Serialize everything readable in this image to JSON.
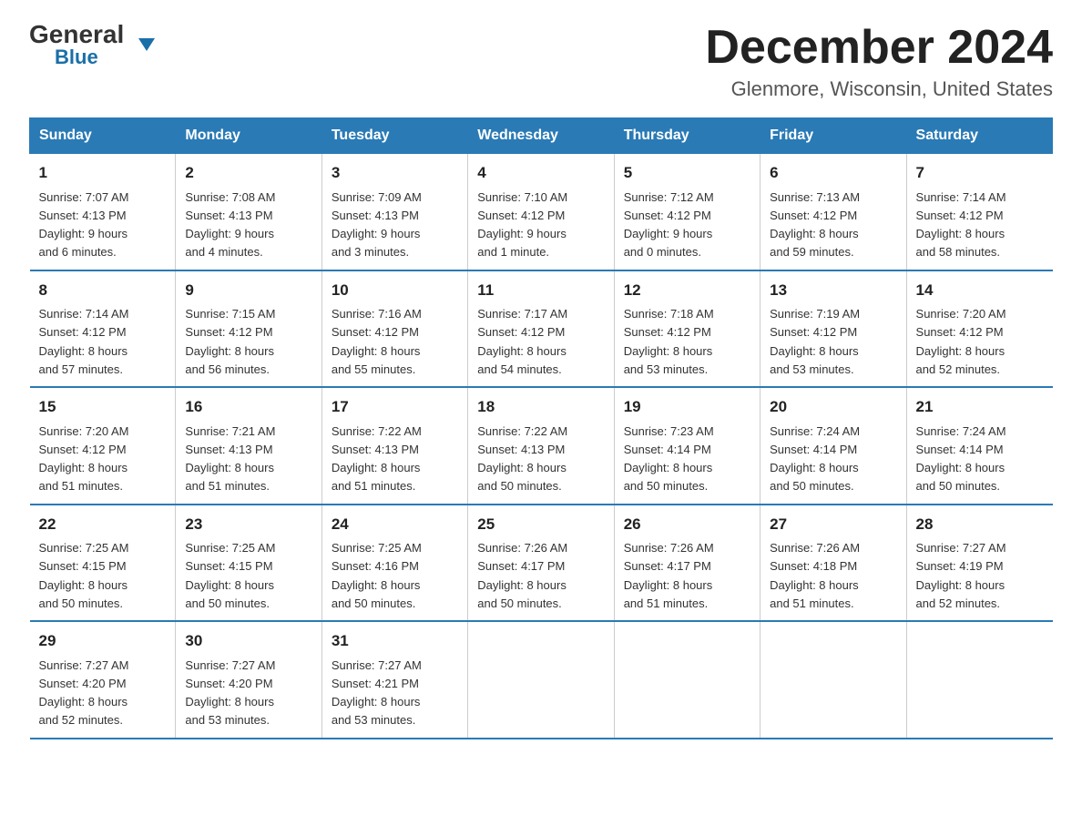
{
  "logo": {
    "general": "General",
    "blue": "Blue",
    "triangle": "▼"
  },
  "title": "December 2024",
  "subtitle": "Glenmore, Wisconsin, United States",
  "days_of_week": [
    "Sunday",
    "Monday",
    "Tuesday",
    "Wednesday",
    "Thursday",
    "Friday",
    "Saturday"
  ],
  "weeks": [
    [
      {
        "num": "1",
        "sunrise": "7:07 AM",
        "sunset": "4:13 PM",
        "daylight": "9 hours and 6 minutes."
      },
      {
        "num": "2",
        "sunrise": "7:08 AM",
        "sunset": "4:13 PM",
        "daylight": "9 hours and 4 minutes."
      },
      {
        "num": "3",
        "sunrise": "7:09 AM",
        "sunset": "4:13 PM",
        "daylight": "9 hours and 3 minutes."
      },
      {
        "num": "4",
        "sunrise": "7:10 AM",
        "sunset": "4:12 PM",
        "daylight": "9 hours and 1 minute."
      },
      {
        "num": "5",
        "sunrise": "7:12 AM",
        "sunset": "4:12 PM",
        "daylight": "9 hours and 0 minutes."
      },
      {
        "num": "6",
        "sunrise": "7:13 AM",
        "sunset": "4:12 PM",
        "daylight": "8 hours and 59 minutes."
      },
      {
        "num": "7",
        "sunrise": "7:14 AM",
        "sunset": "4:12 PM",
        "daylight": "8 hours and 58 minutes."
      }
    ],
    [
      {
        "num": "8",
        "sunrise": "7:14 AM",
        "sunset": "4:12 PM",
        "daylight": "8 hours and 57 minutes."
      },
      {
        "num": "9",
        "sunrise": "7:15 AM",
        "sunset": "4:12 PM",
        "daylight": "8 hours and 56 minutes."
      },
      {
        "num": "10",
        "sunrise": "7:16 AM",
        "sunset": "4:12 PM",
        "daylight": "8 hours and 55 minutes."
      },
      {
        "num": "11",
        "sunrise": "7:17 AM",
        "sunset": "4:12 PM",
        "daylight": "8 hours and 54 minutes."
      },
      {
        "num": "12",
        "sunrise": "7:18 AM",
        "sunset": "4:12 PM",
        "daylight": "8 hours and 53 minutes."
      },
      {
        "num": "13",
        "sunrise": "7:19 AM",
        "sunset": "4:12 PM",
        "daylight": "8 hours and 53 minutes."
      },
      {
        "num": "14",
        "sunrise": "7:20 AM",
        "sunset": "4:12 PM",
        "daylight": "8 hours and 52 minutes."
      }
    ],
    [
      {
        "num": "15",
        "sunrise": "7:20 AM",
        "sunset": "4:12 PM",
        "daylight": "8 hours and 51 minutes."
      },
      {
        "num": "16",
        "sunrise": "7:21 AM",
        "sunset": "4:13 PM",
        "daylight": "8 hours and 51 minutes."
      },
      {
        "num": "17",
        "sunrise": "7:22 AM",
        "sunset": "4:13 PM",
        "daylight": "8 hours and 51 minutes."
      },
      {
        "num": "18",
        "sunrise": "7:22 AM",
        "sunset": "4:13 PM",
        "daylight": "8 hours and 50 minutes."
      },
      {
        "num": "19",
        "sunrise": "7:23 AM",
        "sunset": "4:14 PM",
        "daylight": "8 hours and 50 minutes."
      },
      {
        "num": "20",
        "sunrise": "7:24 AM",
        "sunset": "4:14 PM",
        "daylight": "8 hours and 50 minutes."
      },
      {
        "num": "21",
        "sunrise": "7:24 AM",
        "sunset": "4:14 PM",
        "daylight": "8 hours and 50 minutes."
      }
    ],
    [
      {
        "num": "22",
        "sunrise": "7:25 AM",
        "sunset": "4:15 PM",
        "daylight": "8 hours and 50 minutes."
      },
      {
        "num": "23",
        "sunrise": "7:25 AM",
        "sunset": "4:15 PM",
        "daylight": "8 hours and 50 minutes."
      },
      {
        "num": "24",
        "sunrise": "7:25 AM",
        "sunset": "4:16 PM",
        "daylight": "8 hours and 50 minutes."
      },
      {
        "num": "25",
        "sunrise": "7:26 AM",
        "sunset": "4:17 PM",
        "daylight": "8 hours and 50 minutes."
      },
      {
        "num": "26",
        "sunrise": "7:26 AM",
        "sunset": "4:17 PM",
        "daylight": "8 hours and 51 minutes."
      },
      {
        "num": "27",
        "sunrise": "7:26 AM",
        "sunset": "4:18 PM",
        "daylight": "8 hours and 51 minutes."
      },
      {
        "num": "28",
        "sunrise": "7:27 AM",
        "sunset": "4:19 PM",
        "daylight": "8 hours and 52 minutes."
      }
    ],
    [
      {
        "num": "29",
        "sunrise": "7:27 AM",
        "sunset": "4:20 PM",
        "daylight": "8 hours and 52 minutes."
      },
      {
        "num": "30",
        "sunrise": "7:27 AM",
        "sunset": "4:20 PM",
        "daylight": "8 hours and 53 minutes."
      },
      {
        "num": "31",
        "sunrise": "7:27 AM",
        "sunset": "4:21 PM",
        "daylight": "8 hours and 53 minutes."
      },
      {
        "num": "",
        "sunrise": "",
        "sunset": "",
        "daylight": ""
      },
      {
        "num": "",
        "sunrise": "",
        "sunset": "",
        "daylight": ""
      },
      {
        "num": "",
        "sunrise": "",
        "sunset": "",
        "daylight": ""
      },
      {
        "num": "",
        "sunrise": "",
        "sunset": "",
        "daylight": ""
      }
    ]
  ]
}
